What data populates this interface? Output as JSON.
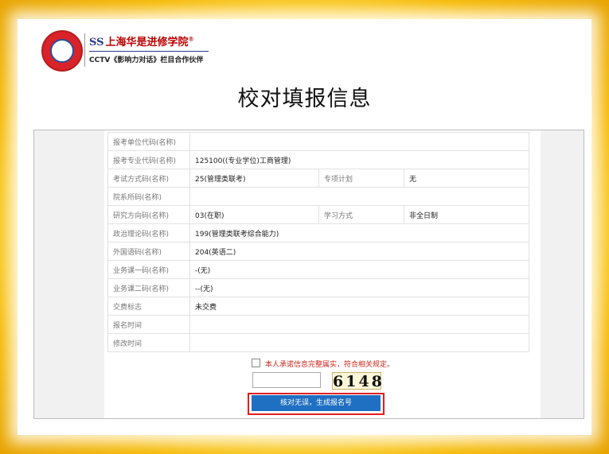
{
  "logo": {
    "ss_mark": "SS",
    "school_name": "上海华是进修学院",
    "registered_mark": "®",
    "partner_line": "CCTV《影响力对话》栏目合作伙伴"
  },
  "page_title": "校对填报信息",
  "form_rows": [
    {
      "label": "报考单位代码(名称)",
      "value": ""
    },
    {
      "label": "报考专业代码(名称)",
      "value": "125100((专业学位)工商管理)"
    },
    {
      "label": "考试方式码(名称)",
      "value": "25(管理类联考)",
      "label2": "专项计划",
      "value2": "无"
    },
    {
      "label": "院系所码(名称)",
      "value": ""
    },
    {
      "label": "研究方向码(名称)",
      "value": "03(在职)",
      "label2": "学习方式",
      "value2": "非全日制"
    },
    {
      "label": "政治理论码(名称)",
      "value": "199(管理类联考综合能力)"
    },
    {
      "label": "外国语码(名称)",
      "value": "204(英语二)"
    },
    {
      "label": "业务课一码(名称)",
      "value": "-(无)"
    },
    {
      "label": "业务课二码(名称)",
      "value": "--(无)"
    },
    {
      "label": "交费标志",
      "value": "未交费"
    },
    {
      "label": "报名时间",
      "value": ""
    },
    {
      "label": "修改时间",
      "value": ""
    }
  ],
  "agreement_text": "本人承诺信息完整属实，符合相关规定。",
  "captcha": {
    "input_value": "",
    "code": "6148"
  },
  "submit_label": "核对无误，生成报名号",
  "colors": {
    "submit_bg": "#1f6fc2",
    "highlight_border": "#e21d1d",
    "agreement_text": "#d0261c"
  }
}
